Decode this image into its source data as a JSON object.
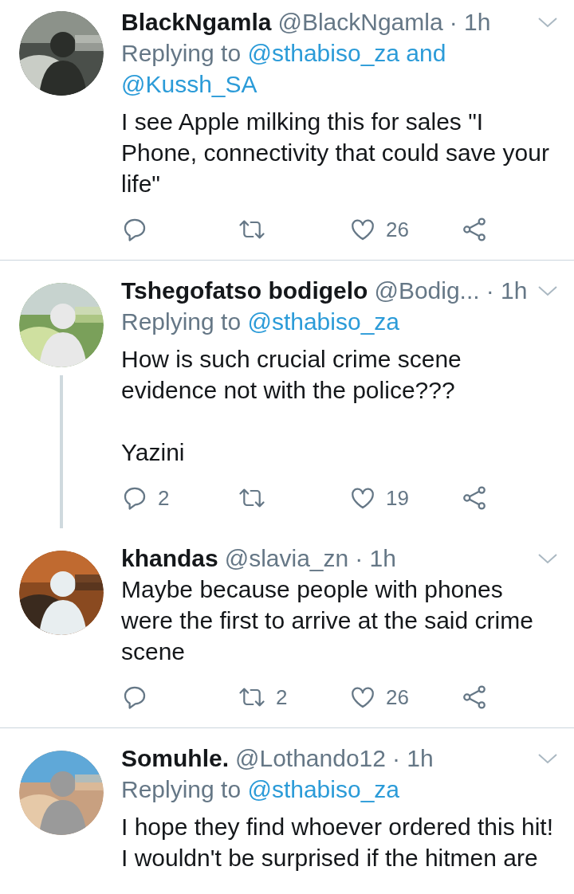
{
  "tweets": [
    {
      "name": "BlackNgamla",
      "handle": "@BlackNgamla",
      "time": "· 1h",
      "replying_prefix": "Replying to",
      "replying_targets": "@sthabiso_za and @Kussh_SA",
      "paragraphs": [
        "I see Apple milking this for sales \"I Phone, connectivity that could save your life\""
      ],
      "actions": {
        "likes": "26"
      },
      "thread_line": false,
      "divider": true
    },
    {
      "name": "Tshegofatso bodigelo",
      "handle": "@Bodig...",
      "time": "· 1h",
      "replying_prefix": "Replying to",
      "replying_targets": "@sthabiso_za",
      "paragraphs": [
        "How is such crucial crime scene evidence not with the police???",
        "Yazini"
      ],
      "actions": {
        "replies": "2",
        "likes": "19"
      },
      "thread_line": true,
      "divider": false
    },
    {
      "name": "khandas",
      "handle": "@slavia_zn",
      "time": "· 1h",
      "paragraphs": [
        "Maybe because people with phones were the first to arrive at the said crime scene"
      ],
      "actions": {
        "retweets": "2",
        "likes": "26"
      },
      "thread_line": false,
      "divider": true
    },
    {
      "name": "Somuhle.",
      "handle": "@Lothando12",
      "time": "· 1h",
      "replying_prefix": "Replying to",
      "replying_targets": "@sthabiso_za",
      "paragraphs": [
        "I hope they find whoever ordered this hit! I wouldn't be surprised if the hitmen are"
      ],
      "thread_line": false,
      "divider": false
    }
  ]
}
